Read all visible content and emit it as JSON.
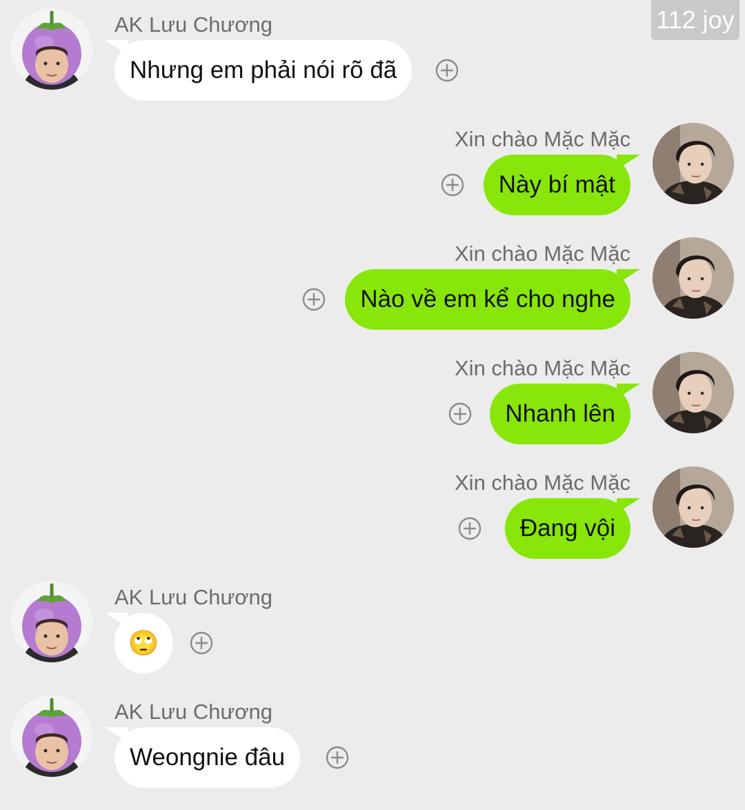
{
  "watermark": "112 joy",
  "messages": [
    {
      "sender": "AK Lưu Chương",
      "side": "left",
      "text": "Nhưng em phải nói rõ đã"
    },
    {
      "sender": "Xin chào Mặc Mặc",
      "side": "right",
      "text": "Này bí mật"
    },
    {
      "sender": "Xin chào Mặc Mặc",
      "side": "right",
      "text": "Nào về em kể cho nghe"
    },
    {
      "sender": "Xin chào Mặc Mặc",
      "side": "right",
      "text": "Nhanh lên"
    },
    {
      "sender": "Xin chào Mặc Mặc",
      "side": "right",
      "text": "Đang vội"
    },
    {
      "sender": "AK Lưu Chương",
      "side": "left",
      "text": "🙄"
    },
    {
      "sender": "AK Lưu Chương",
      "side": "left",
      "text": "Weongnie đâu"
    }
  ],
  "colors": {
    "background": "#ececec",
    "outgoing_bubble": "#88e60b",
    "incoming_bubble": "#ffffff",
    "sender_name": "#6c6c6c"
  },
  "icons": {
    "add": "plus-circle-icon",
    "left_avatar": "eggplant-hat-avatar",
    "right_avatar": "portrait-avatar"
  }
}
